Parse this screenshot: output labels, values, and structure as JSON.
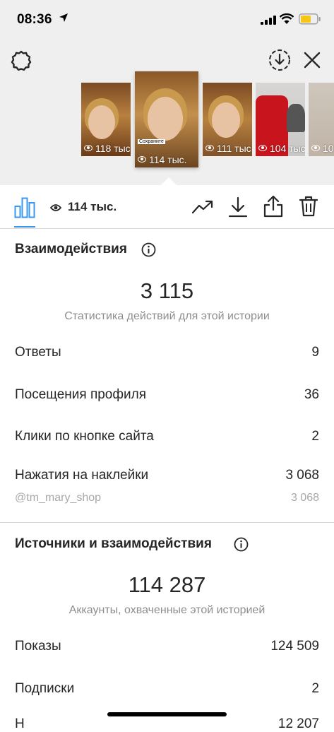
{
  "status_bar": {
    "time": "08:36"
  },
  "thumbnails": [
    {
      "views": "118 тыс."
    },
    {
      "views": "114 тыс.",
      "sticker": "Сохраните"
    },
    {
      "views": "111 тыс."
    },
    {
      "views": "104 тыс."
    },
    {
      "views": "10"
    }
  ],
  "toolbar": {
    "views": "114 тыс."
  },
  "interactions": {
    "title": "Взаимодействия",
    "total": "3 115",
    "subtitle": "Статистика действий для этой истории",
    "rows": [
      {
        "label": "Ответы",
        "value": "9"
      },
      {
        "label": "Посещения профиля",
        "value": "36"
      },
      {
        "label": "Клики по кнопке сайта",
        "value": "2"
      },
      {
        "label": "Нажатия на наклейки",
        "value": "3 068"
      }
    ],
    "sticker_row": {
      "label": "@tm_mary_shop",
      "value": "3 068"
    }
  },
  "discovery": {
    "title": "Источники и взаимодействия",
    "total": "114 287",
    "subtitle": "Аккаунты, охваченные этой историей",
    "rows": [
      {
        "label": "Показы",
        "value": "124 509"
      },
      {
        "label": "Подписки",
        "value": "2"
      },
      {
        "label": "Н",
        "value": "12 207"
      }
    ]
  },
  "colors": {
    "accent": "#3897f0",
    "text": "#262626",
    "secondary": "#8e8e8e"
  }
}
